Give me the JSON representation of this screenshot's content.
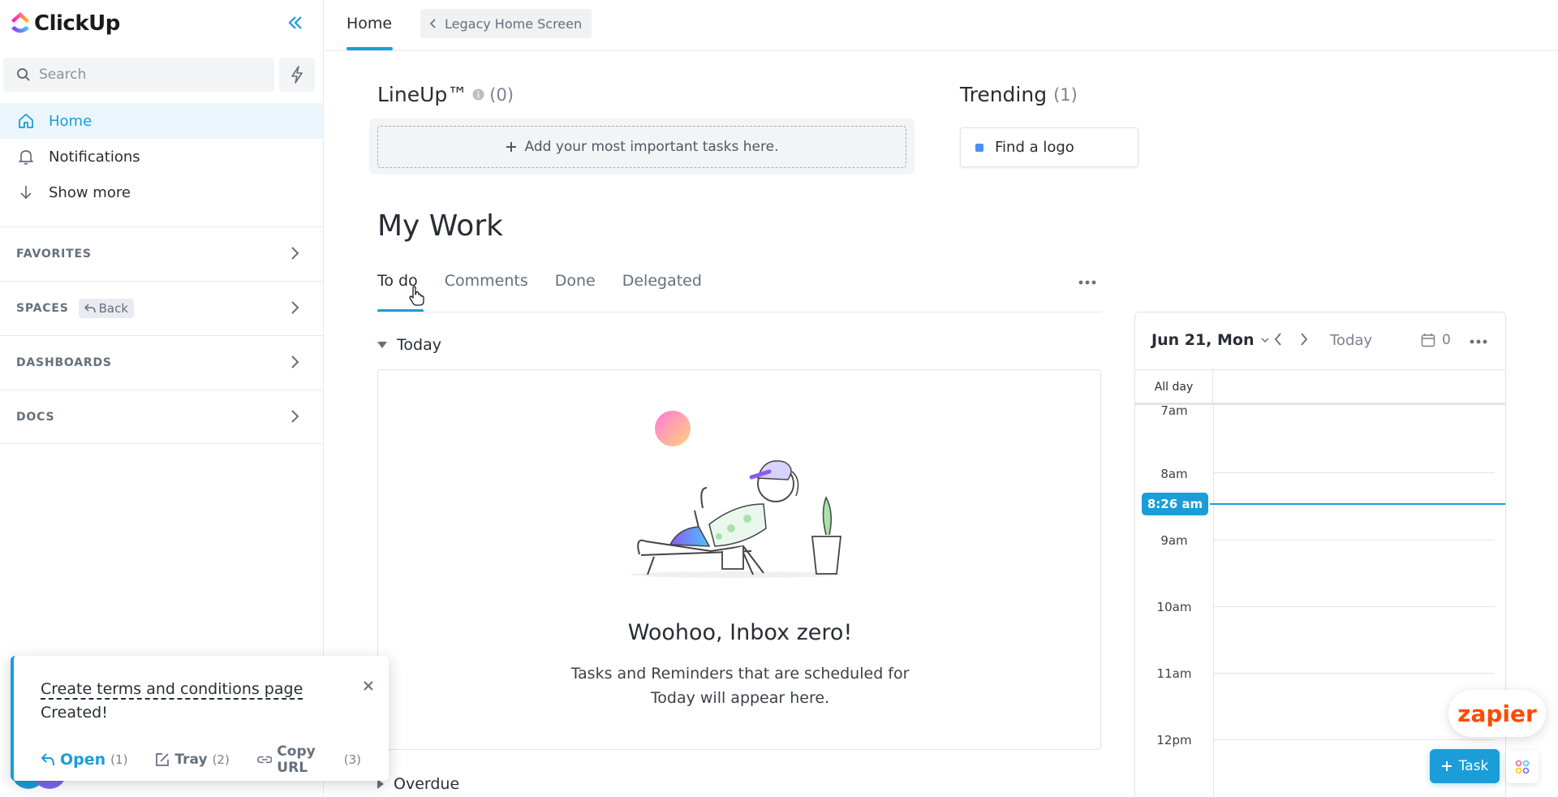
{
  "app": {
    "logo_text": "ClickUp",
    "accent": "#1a9dd9"
  },
  "sidebar": {
    "search_placeholder": "Search",
    "nav": [
      {
        "label": "Home",
        "icon": "home-icon",
        "active": true
      },
      {
        "label": "Notifications",
        "icon": "bell-icon"
      },
      {
        "label": "Show more",
        "icon": "arrow-down-icon"
      }
    ],
    "sections": [
      {
        "label": "FAVORITES"
      },
      {
        "label": "SPACES",
        "pill": "Back"
      },
      {
        "label": "DASHBOARDS"
      },
      {
        "label": "DOCS"
      }
    ]
  },
  "topbar": {
    "tab": "Home",
    "legacy": "Legacy Home Screen"
  },
  "lineup": {
    "title": "LineUp™",
    "count": "(0)",
    "placeholder": "Add your most important tasks here."
  },
  "trending": {
    "title": "Trending",
    "count": "(1)",
    "items": [
      {
        "label": "Find a logo",
        "color": "#4a8ef4"
      }
    ]
  },
  "mywork": {
    "title": "My Work",
    "tabs": [
      "To do",
      "Comments",
      "Done",
      "Delegated"
    ],
    "active_tab": "To do",
    "today_label": "Today",
    "overdue_label": "Overdue",
    "empty_title": "Woohoo, Inbox zero!",
    "empty_line1": "Tasks and Reminders that are scheduled for",
    "empty_line2": "Today will appear here."
  },
  "calendar": {
    "date": "Jun 21, Mon",
    "today": "Today",
    "count": "0",
    "allday": "All day",
    "hours": [
      "7am",
      "8am",
      "9am",
      "10am",
      "11am",
      "12pm"
    ],
    "now": "8:26 am"
  },
  "toast": {
    "title": "Create terms and conditions page",
    "subtitle": "Created!",
    "actions": [
      {
        "label": "Open",
        "num": "(1)"
      },
      {
        "label": "Tray",
        "num": "(2)"
      },
      {
        "label": "Copy URL",
        "num": "(3)"
      }
    ]
  },
  "floating": {
    "zapier": "zapier",
    "task": "Task"
  }
}
